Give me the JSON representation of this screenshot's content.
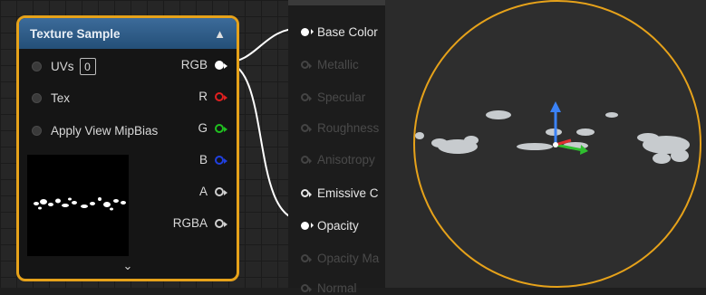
{
  "texture_sample": {
    "title": "Texture Sample",
    "inputs": [
      {
        "label": "UVs",
        "value": "0"
      },
      {
        "label": "Tex"
      },
      {
        "label": "Apply View MipBias"
      }
    ],
    "outputs": [
      {
        "label": "RGB",
        "color": "#ffffff"
      },
      {
        "label": "R",
        "color": "#e02020"
      },
      {
        "label": "G",
        "color": "#20c020"
      },
      {
        "label": "B",
        "color": "#2040e0"
      },
      {
        "label": "A",
        "color": "#cfcfcf"
      },
      {
        "label": "RGBA",
        "color": "#cfcfcf"
      }
    ],
    "collapse_icon": "chevron-up-icon",
    "expand_icon": "chevron-down-icon"
  },
  "material_inputs": [
    {
      "label": "Base Color",
      "active": true
    },
    {
      "label": "Metallic",
      "active": false
    },
    {
      "label": "Specular",
      "active": false
    },
    {
      "label": "Roughness",
      "active": false
    },
    {
      "label": "Anisotropy",
      "active": false
    },
    {
      "label": "Emissive C",
      "active": true
    },
    {
      "label": "Opacity",
      "active": true
    },
    {
      "label": "Opacity Ma",
      "active": false
    },
    {
      "label": "Normal",
      "active": false
    }
  ],
  "colors": {
    "node_border": "#e6a21a",
    "header": "#2d5c8a",
    "wire": "#ffffff",
    "sphere_outline": "#e6a21a"
  }
}
